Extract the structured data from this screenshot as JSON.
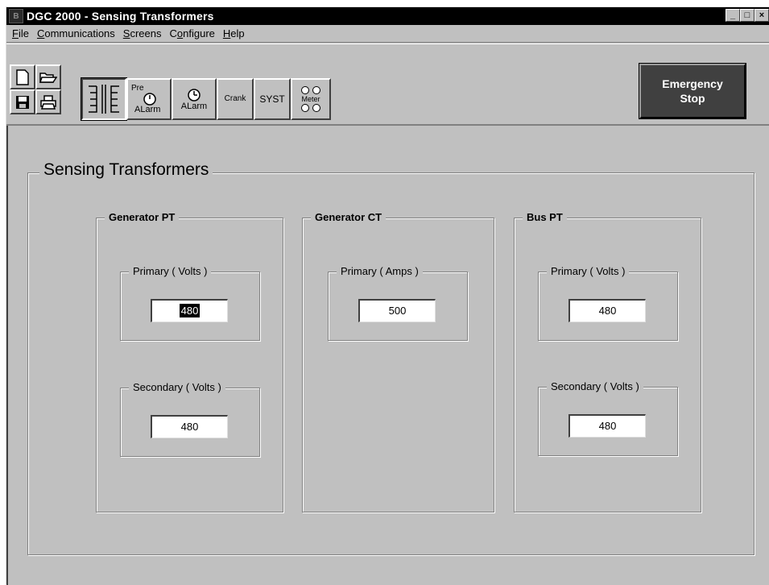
{
  "window": {
    "title": "DGC 2000 - Sensing Transformers",
    "buttons": {
      "minimize": "_",
      "maximize": "□",
      "close": "×"
    }
  },
  "menu": [
    {
      "label": "File",
      "key": "F",
      "rest": "ile"
    },
    {
      "label": "Communications",
      "key": "C",
      "rest": "ommunications"
    },
    {
      "label": "Screens",
      "key": "S",
      "rest": "creens"
    },
    {
      "label": "Configure",
      "key": "o",
      "pre": "C",
      "rest": "nfigure"
    },
    {
      "label": "Help",
      "key": "H",
      "rest": "elp"
    }
  ],
  "toolbar": {
    "new_icon": "new-document-icon",
    "open_icon": "open-folder-icon",
    "save_icon": "save-disk-icon",
    "print_icon": "printer-icon",
    "sensing_icon": "transformer-icon",
    "pre_alarm": {
      "line1": "Pre",
      "line2": "ALarm"
    },
    "alarm": {
      "label": "ALarm"
    },
    "crank": "Crank",
    "syst": "SYST",
    "meter": "Meter",
    "emergency_stop": {
      "line1": "Emergency",
      "line2": "Stop"
    }
  },
  "main": {
    "section_title": "Sensing Transformers",
    "generator_pt": {
      "title": "Generator PT",
      "primary_label": "Primary ( Volts )",
      "primary_value": "480",
      "secondary_label": "Secondary ( Volts )",
      "secondary_value": "480"
    },
    "generator_ct": {
      "title": "Generator CT",
      "primary_label": "Primary ( Amps )",
      "primary_value": "500"
    },
    "bus_pt": {
      "title": "Bus PT",
      "primary_label": "Primary ( Volts )",
      "primary_value": "480",
      "secondary_label": "Secondary ( Volts )",
      "secondary_value": "480"
    }
  }
}
